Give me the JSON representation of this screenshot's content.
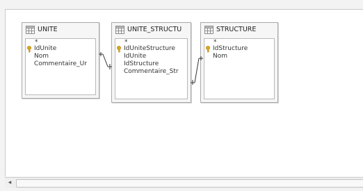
{
  "tables": [
    {
      "title": "UNITE",
      "fields": [
        {
          "name": "*",
          "key": false
        },
        {
          "name": "IdUnite",
          "key": true
        },
        {
          "name": "Nom",
          "key": false
        },
        {
          "name": "Commentaire_Ur",
          "key": false
        }
      ]
    },
    {
      "title": "UNITE_STRUCTU",
      "fields": [
        {
          "name": "*",
          "key": false
        },
        {
          "name": "IdUniteStructure",
          "key": true
        },
        {
          "name": "IdUnite",
          "key": false
        },
        {
          "name": "IdStructure",
          "key": false
        },
        {
          "name": "Commentaire_Str",
          "key": false
        }
      ]
    },
    {
      "title": "STRUCTURE",
      "fields": [
        {
          "name": "*",
          "key": false
        },
        {
          "name": "IdStructure",
          "key": true
        },
        {
          "name": "Nom",
          "key": false
        }
      ]
    }
  ],
  "scrollbar": {
    "left_arrow": "◂"
  },
  "colors": {
    "key_icon": "#d4a017",
    "border": "#a9a9a9"
  }
}
